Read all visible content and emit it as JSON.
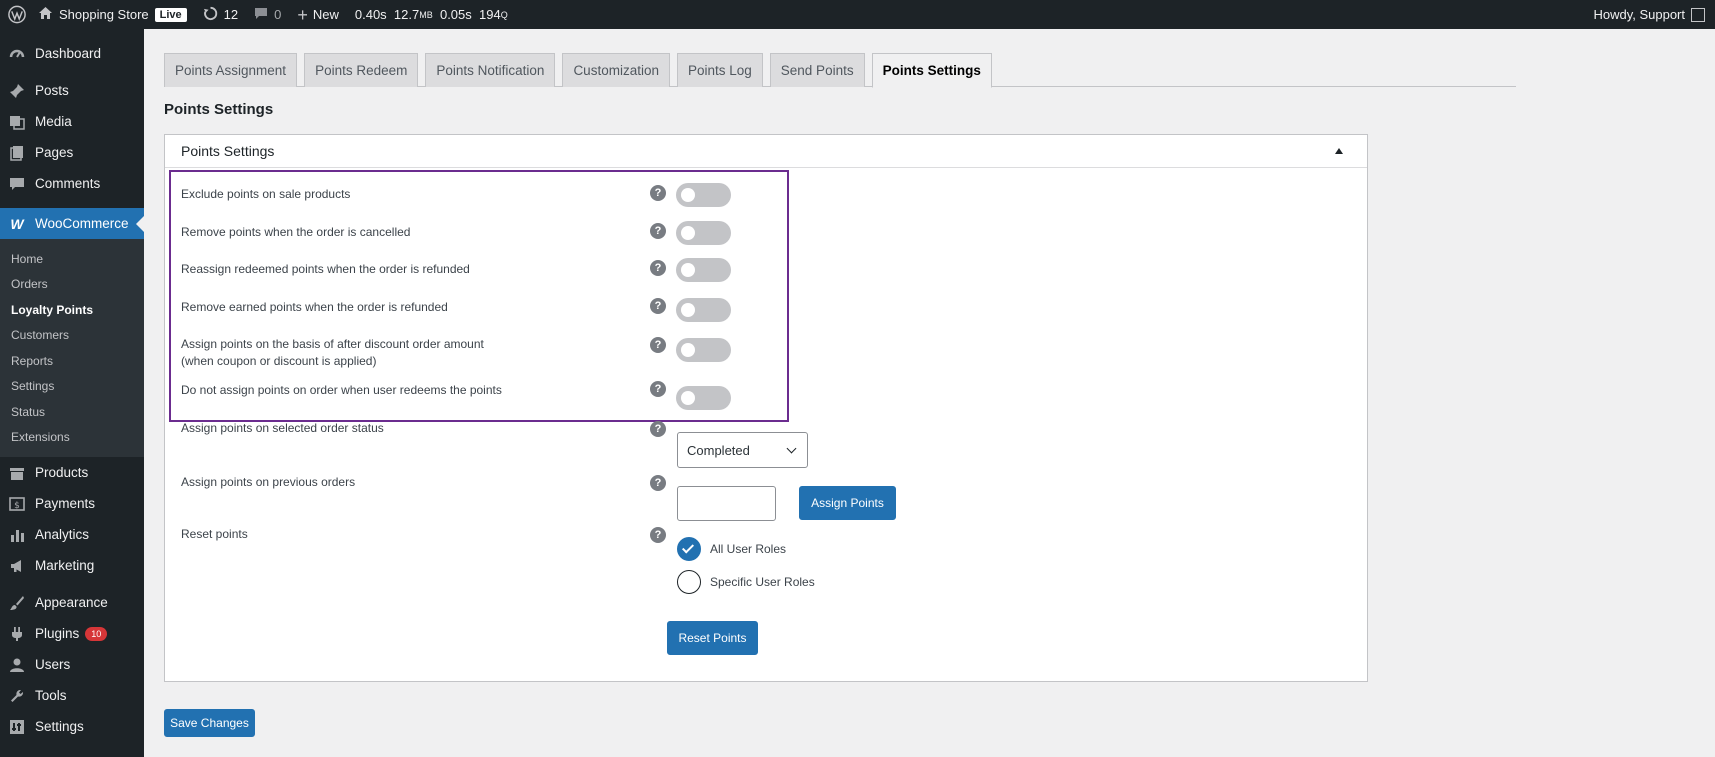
{
  "adminbar": {
    "site_name": "Shopping Store",
    "live_label": "Live",
    "updates_count": "12",
    "comments_count": "0",
    "new_label": "New",
    "perf_time": "0.40s",
    "perf_mem_value": "12.7",
    "perf_mem_unit": "MB",
    "perf_query_time": "0.05s",
    "perf_queries_value": "194",
    "perf_queries_unit": "Q",
    "howdy": "Howdy, Support"
  },
  "sidebar": {
    "items_top": [
      {
        "label": "Dashboard",
        "icon": "dashboard-icon"
      },
      {
        "label": "Posts",
        "icon": "pin-icon"
      },
      {
        "label": "Media",
        "icon": "media-icon"
      },
      {
        "label": "Pages",
        "icon": "pages-icon"
      },
      {
        "label": "Comments",
        "icon": "comment-icon"
      }
    ],
    "woocommerce": {
      "label": "WooCommerce",
      "icon": "woo-icon"
    },
    "submenu": [
      {
        "label": "Home"
      },
      {
        "label": "Orders"
      },
      {
        "label": "Loyalty Points",
        "current": true
      },
      {
        "label": "Customers"
      },
      {
        "label": "Reports"
      },
      {
        "label": "Settings"
      },
      {
        "label": "Status"
      },
      {
        "label": "Extensions"
      }
    ],
    "items_bottom": [
      {
        "label": "Products",
        "icon": "products-icon"
      },
      {
        "label": "Payments",
        "icon": "payments-icon"
      },
      {
        "label": "Analytics",
        "icon": "analytics-icon"
      },
      {
        "label": "Marketing",
        "icon": "megaphone-icon"
      },
      {
        "label": "Appearance",
        "icon": "brush-icon"
      },
      {
        "label": "Plugins",
        "icon": "plug-icon",
        "badge": "10"
      },
      {
        "label": "Users",
        "icon": "user-icon"
      },
      {
        "label": "Tools",
        "icon": "wrench-icon"
      },
      {
        "label": "Settings",
        "icon": "settings-icon"
      }
    ]
  },
  "tabs": [
    {
      "label": "Points Assignment"
    },
    {
      "label": "Points Redeem"
    },
    {
      "label": "Points Notification"
    },
    {
      "label": "Customization"
    },
    {
      "label": "Points Log"
    },
    {
      "label": "Send Points"
    },
    {
      "label": "Points Settings",
      "active": true
    }
  ],
  "page_title": "Points Settings",
  "panel": {
    "title": "Points Settings",
    "toggles": [
      {
        "label": "Exclude points on sale products",
        "on": false
      },
      {
        "label": "Remove points when the order is cancelled",
        "on": false
      },
      {
        "label": "Reassign redeemed points when the order is refunded",
        "on": false
      },
      {
        "label": "Remove earned points when the order is refunded",
        "on": false
      },
      {
        "label": "Assign points on the basis of after discount order amount",
        "label_line2": "(when coupon or discount is applied)",
        "on": false
      },
      {
        "label": "Do not assign points on order when user redeems the points",
        "on": false
      }
    ],
    "order_status": {
      "label": "Assign points on selected order status",
      "value": "Completed"
    },
    "previous_orders": {
      "label": "Assign points on previous orders",
      "input_value": "",
      "button": "Assign Points"
    },
    "reset": {
      "label": "Reset points",
      "options": [
        {
          "label": "All User Roles",
          "checked": true
        },
        {
          "label": "Specific User Roles",
          "checked": false
        }
      ],
      "button": "Reset Points"
    }
  },
  "save_button": "Save Changes",
  "colors": {
    "accent": "#2271b1",
    "adminbar": "#1d2327",
    "highlight": "#6b2c8f"
  }
}
